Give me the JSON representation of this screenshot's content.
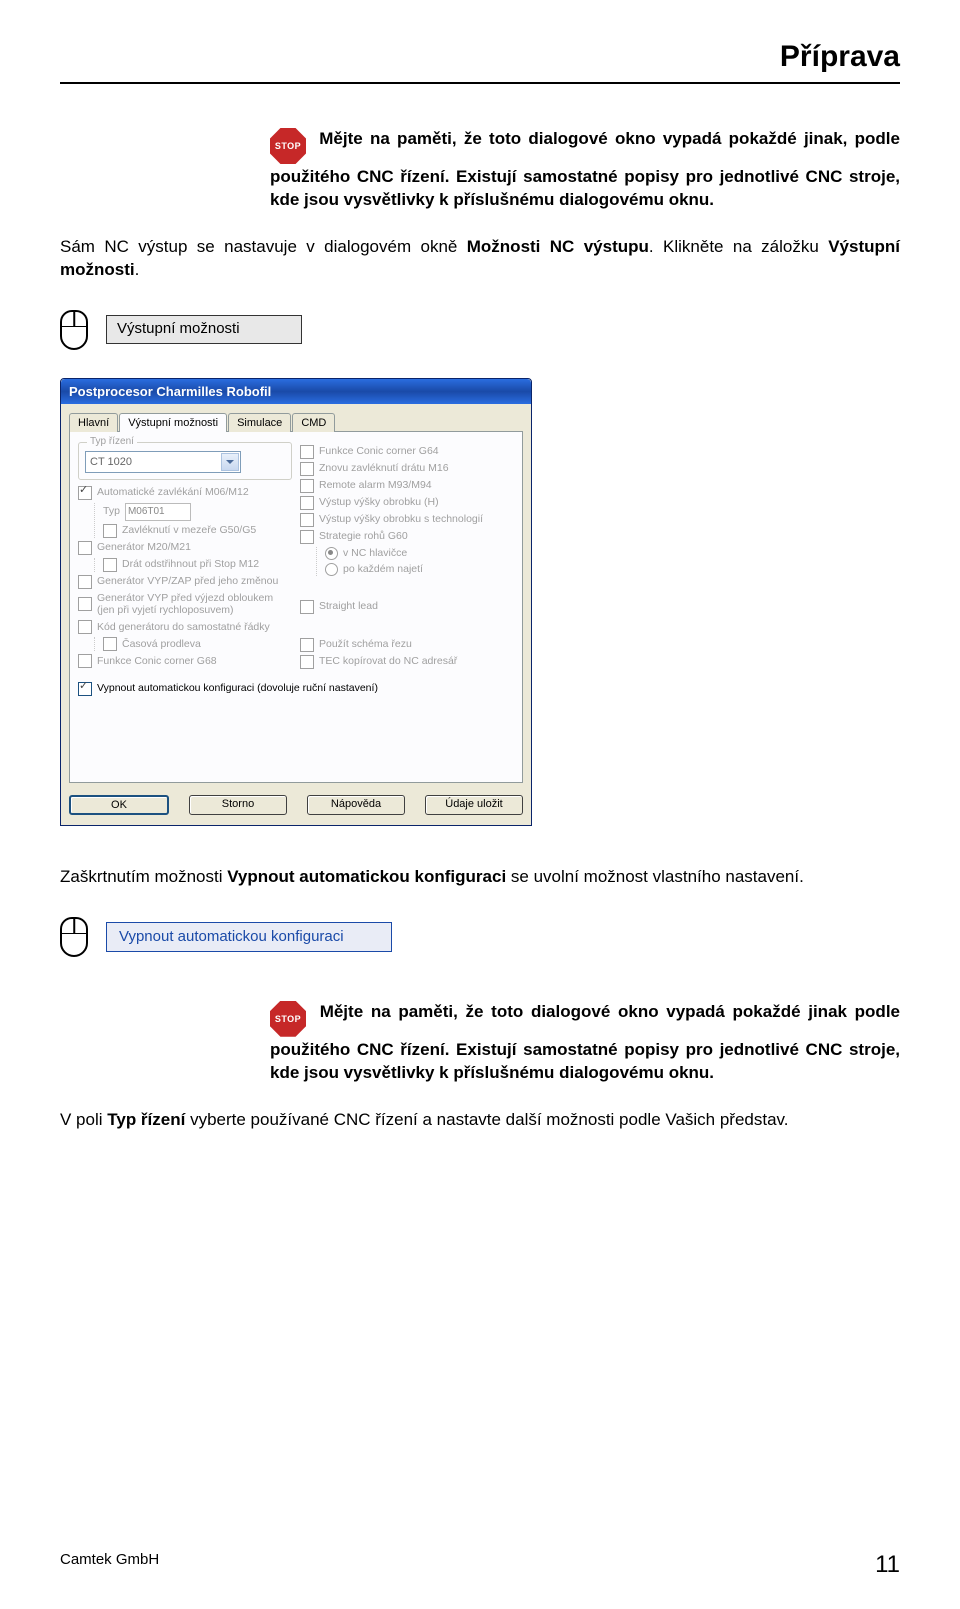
{
  "header": {
    "title": "Příprava"
  },
  "stop_icon": {
    "label": "STOP"
  },
  "note1_prefix": "Mějte na paměti, že toto dialogové okno vypadá pokaždé jinak, podle použitého CNC řízení. Existují samostatné popisy pro jednotlivé CNC stroje, kde jsou vysvětlivky k příslušnému dialogovému oknu.",
  "para2_a": "Sám NC výstup se nastavuje v dialogovém okně ",
  "para2_b": "Možnosti NC výstupu",
  "para2_c": ".   Klikněte na záložku ",
  "para2_d": "Výstupní možnosti",
  "para2_e": ".",
  "tab_button1": "Výstupní možnosti",
  "dialog": {
    "title": "Postprocesor Charmilles Robofil",
    "tabs": [
      "Hlavní",
      "Výstupní možnosti",
      "Simulace",
      "CMD"
    ],
    "left": {
      "group1_legend": "Typ řízení",
      "combo_value": "CT 1020",
      "auto_m06": "Automatické zavlékání M06/M12",
      "typ_label": "Typ",
      "typ_value": "M06T01",
      "zavleknuti": "Zavléknutí v mezeře G50/G5",
      "gen_m20": "Generátor M20/M21",
      "drat_stop": "Drát odstřihnout při Stop M12",
      "gen_vypzap": "Generátor VYP/ZAP před jeho změnou",
      "gen_vyjezd": "Generátor VYP před výjezd obloukem (jen při vyjetí rychloposuvem)",
      "kod_gen": "Kód generátoru do samostatné řádky",
      "casova": "Časová prodleva",
      "conic_g68": "Funkce Conic corner G68"
    },
    "right": {
      "conic_g64": "Funkce Conic corner G64",
      "znovu_m16": "Znovu zavléknutí drátu M16",
      "remote": "Remote alarm M93/M94",
      "vystup_h": "Výstup výšky obrobku (H)",
      "vystup_tech": "Výstup výšky obrobku s technologií",
      "strategie_group": "Strategie rohů G60",
      "r1": "v NC hlavičce",
      "r2": "po každém najetí",
      "straight": "Straight lead",
      "schema": "Použít schéma řezu",
      "tec": "TEC kopírovat do NC adresář"
    },
    "bottom_checkbox": "Vypnout automatickou konfiguraci (dovoluje ruční nastavení)",
    "buttons": [
      "OK",
      "Storno",
      "Nápověda",
      "Údaje uložit"
    ]
  },
  "para3_a": "Zaškrtnutím možnosti ",
  "para3_b": "Vypnout automatickou konfiguraci",
  "para3_c": " se uvolní možnost vlastního nastavení.",
  "blue_button": "Vypnout automatickou konfiguraci",
  "note2": "Mějte na paměti, že toto dialogové okno vypadá pokaždé jinak podle použitého CNC řízení. Existují samostatné popisy pro jednotlivé CNC stroje, kde jsou vysvětlivky k příslušnému dialogovému oknu.",
  "para4_a": "V poli ",
  "para4_b": "Typ řízení",
  "para4_c": " vyberte používané CNC řízení a nastavte další možnosti podle Vašich představ.",
  "footer": {
    "company": "Camtek GmbH",
    "page": "11"
  }
}
